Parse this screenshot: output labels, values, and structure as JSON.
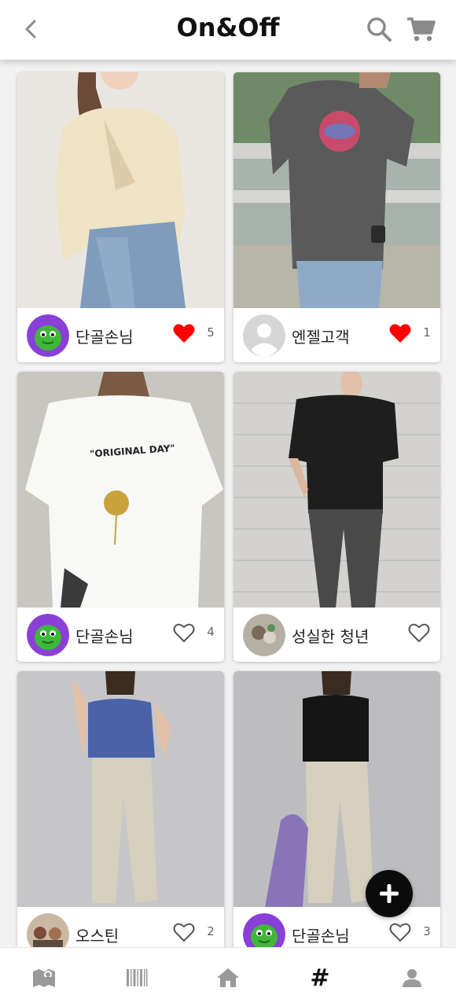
{
  "header": {
    "title": "On&Off"
  },
  "posts": [
    {
      "user": "단골손님",
      "avatar": "green-character-avatar",
      "likes": "5",
      "liked": true
    },
    {
      "user": "엔젤고객",
      "avatar": "default-person-avatar",
      "likes": "1",
      "liked": true
    },
    {
      "user": "단골손님",
      "avatar": "green-character-avatar",
      "likes": "4",
      "liked": false
    },
    {
      "user": "성실한 청년",
      "avatar": "photo-avatar",
      "likes": "",
      "liked": false
    },
    {
      "user": "오스틴",
      "avatar": "photo-avatar",
      "likes": "2",
      "liked": false
    },
    {
      "user": "단골손님",
      "avatar": "green-character-avatar",
      "likes": "3",
      "liked": false
    }
  ],
  "colors": {
    "liked": "#ff0000",
    "accent": "#0b0b0b",
    "navActive": "#111111",
    "navInactive": "#9a9a9a"
  },
  "nav": [
    {
      "name": "map",
      "icon": "map-icon"
    },
    {
      "name": "barcode",
      "icon": "barcode-icon"
    },
    {
      "name": "home",
      "icon": "home-icon"
    },
    {
      "name": "hashtag",
      "icon": "hashtag-icon",
      "label": "#",
      "active": true
    },
    {
      "name": "profile",
      "icon": "user-icon"
    }
  ]
}
